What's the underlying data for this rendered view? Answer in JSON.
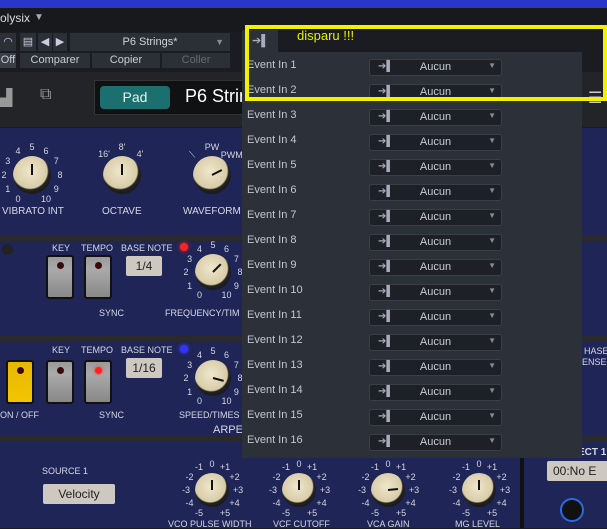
{
  "host": {
    "plugin_name": "olysix",
    "preset_name": "P6 Strings*",
    "off_label": "Off",
    "compare_label": "Comparer",
    "copy_label": "Copier",
    "paste_label": "Coller"
  },
  "instrument": {
    "pad_label": "Pad",
    "preset_title": "P6 Strin"
  },
  "annotation": {
    "text": "disparu !!!",
    "color": "#f5f000"
  },
  "event_panel": {
    "rows": [
      {
        "label": "Event In 1",
        "value": "Aucun"
      },
      {
        "label": "Event In 2",
        "value": "Aucun"
      },
      {
        "label": "Event In 3",
        "value": "Aucun"
      },
      {
        "label": "Event In 4",
        "value": "Aucun"
      },
      {
        "label": "Event In 5",
        "value": "Aucun"
      },
      {
        "label": "Event In 6",
        "value": "Aucun"
      },
      {
        "label": "Event In 7",
        "value": "Aucun"
      },
      {
        "label": "Event In 8",
        "value": "Aucun"
      },
      {
        "label": "Event In 9",
        "value": "Aucun"
      },
      {
        "label": "Event In 10",
        "value": "Aucun"
      },
      {
        "label": "Event In 11",
        "value": "Aucun"
      },
      {
        "label": "Event In 12",
        "value": "Aucun"
      },
      {
        "label": "Event In 13",
        "value": "Aucun"
      },
      {
        "label": "Event In 14",
        "value": "Aucun"
      },
      {
        "label": "Event In 15",
        "value": "Aucun"
      },
      {
        "label": "Event In 16",
        "value": "Aucun"
      }
    ]
  },
  "synth": {
    "vibrato_int": "VIBRATO INT",
    "octave": "OCTAVE",
    "waveform": "WAVEFORM",
    "lfo1": {
      "key": "KEY",
      "tempo": "TEMPO",
      "base_note": "BASE NOTE",
      "base_note_value": "1/4",
      "sync": "SYNC",
      "freq": "FREQUENCY/TIM"
    },
    "arp": {
      "key": "KEY",
      "tempo": "TEMPO",
      "base_note": "BASE NOTE",
      "base_note_value": "1/16",
      "sync": "SYNC",
      "onoff": "ON / OFF",
      "speed": "SPEED/TIMES",
      "section": "ARPE"
    },
    "mod": {
      "source": "SOURCE 1",
      "source_value": "Velocity",
      "vco_pw": "VCO PULSE WIDTH",
      "vcf": "VCF CUTOFF",
      "vca": "VCA GAIN",
      "mg": "MG LEVEL",
      "effect": "ECT 1",
      "effect_value": "00:No E"
    },
    "right": {
      "phase": "HASE",
      "ensemble": "ENSEM"
    },
    "knobs": [
      {
        "id": "vibrato",
        "labels": [
          "0",
          "1",
          "2",
          "3",
          "4",
          "5",
          "6",
          "7",
          "8",
          "9",
          "10"
        ],
        "value_index": 5
      },
      {
        "id": "octave",
        "labels": [
          "16'",
          "8'",
          "4'"
        ],
        "value_index": 1
      },
      {
        "id": "waveform",
        "labels": [
          "⟍",
          "PW",
          "PWM"
        ],
        "value_index": 2.4
      },
      {
        "id": "freq",
        "labels": [
          "0",
          "1",
          "2",
          "3",
          "4",
          "5",
          "6",
          "7",
          "8",
          "9",
          "10"
        ],
        "value_index": 6.5
      },
      {
        "id": "speed",
        "labels": [
          "0",
          "1",
          "2",
          "3",
          "4",
          "5",
          "6",
          "7",
          "8",
          "9",
          "10"
        ],
        "value_index": 8.5
      },
      {
        "id": "vcopw",
        "labels": [
          "-5",
          "-4",
          "-3",
          "-2",
          "-1",
          "0",
          "+1",
          "+2",
          "+3",
          "+4",
          "+5"
        ],
        "value_index": 5
      },
      {
        "id": "vcf",
        "labels": [
          "-5",
          "-4",
          "-3",
          "-2",
          "-1",
          "0",
          "+1",
          "+2",
          "+3",
          "+4",
          "+5"
        ],
        "value_index": 5
      },
      {
        "id": "vca",
        "labels": [
          "-5",
          "-4",
          "-3",
          "-2",
          "-1",
          "0",
          "+1",
          "+2",
          "+3",
          "+4",
          "+5"
        ],
        "value_index": 7.8
      },
      {
        "id": "mg",
        "labels": [
          "-5",
          "-4",
          "-3",
          "-2",
          "-1",
          "0",
          "+1",
          "+2",
          "+3",
          "+4",
          "+5"
        ],
        "value_index": 5
      }
    ]
  }
}
